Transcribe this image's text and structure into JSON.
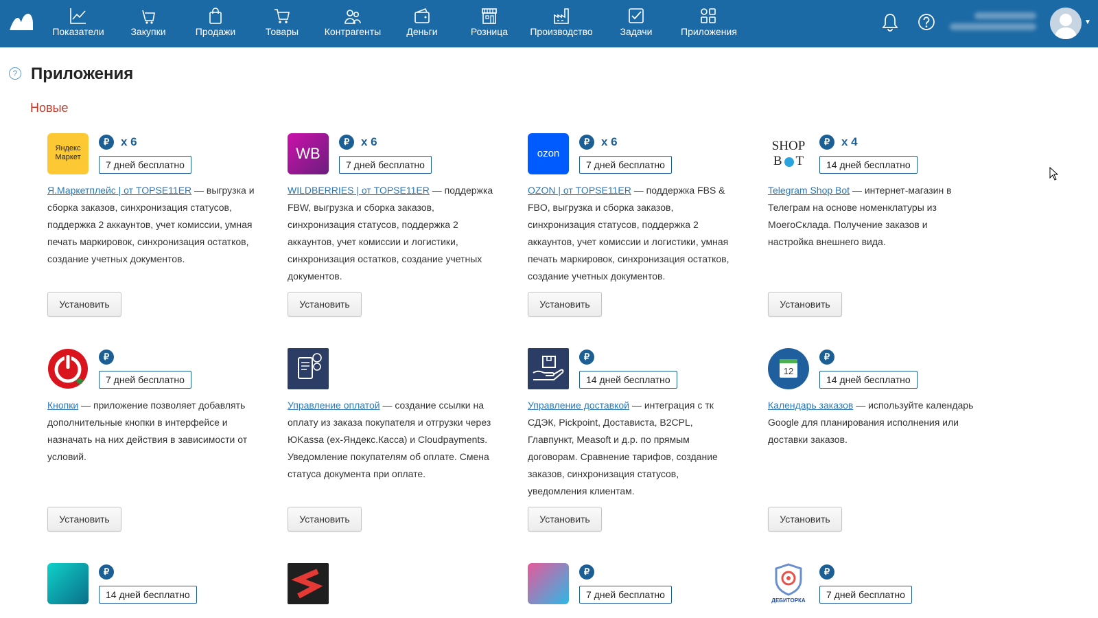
{
  "nav": {
    "items": [
      {
        "label": "Показатели",
        "icon": "chart-line-icon"
      },
      {
        "label": "Закупки",
        "icon": "basket-icon"
      },
      {
        "label": "Продажи",
        "icon": "shopping-bag-icon"
      },
      {
        "label": "Товары",
        "icon": "cart-icon"
      },
      {
        "label": "Контрагенты",
        "icon": "people-icon"
      },
      {
        "label": "Деньги",
        "icon": "wallet-icon"
      },
      {
        "label": "Розница",
        "icon": "storefront-icon"
      },
      {
        "label": "Производство",
        "icon": "factory-icon"
      },
      {
        "label": "Задачи",
        "icon": "checkbox-icon"
      },
      {
        "label": "Приложения",
        "icon": "apps-grid-icon"
      }
    ],
    "colors": {
      "bar": "#1c6aa5",
      "accent": "#1c5f95",
      "link": "#2a79b8",
      "section": "#c0392b"
    }
  },
  "page": {
    "title": "Приложения",
    "section": "Новые",
    "help": "?"
  },
  "apps": [
    {
      "logo_text": [
        "Яндекс",
        "Маркет"
      ],
      "currency": "₽",
      "mult": "x 6",
      "trial": "7 дней бесплатно",
      "link": "Я.Маркетплейс | от TOPSE11ER",
      "text": " — выгрузка и сборка заказов, синхронизация статусов, поддержка 2 аккаунтов, учет комиссии, умная печать маркировок, синхронизация остатков, создание учетных документов.",
      "button": "Установить"
    },
    {
      "logo_text": [
        "WB"
      ],
      "currency": "₽",
      "mult": "x 6",
      "trial": "7 дней бесплатно",
      "link": "WILDBERRIES | от TOPSE11ER",
      "text": " — поддержка FBW, выгрузка и сборка заказов, синхронизация статусов, поддержка 2 аккаунтов, учет комиссии и логистики, синхронизация остатков, создание учетных документов.",
      "button": "Установить"
    },
    {
      "logo_text": [
        "ozon"
      ],
      "currency": "₽",
      "mult": "x 6",
      "trial": "7 дней бесплатно",
      "link": "OZON | от TOPSE11ER",
      "text": " — поддержка FBS & FBO, выгрузка и сборка заказов, синхронизация статусов, поддержка 2 аккаунтов, учет комиссии и логистики, умная печать маркировок, синхронизация остатков, создание учетных документов.",
      "button": "Установить"
    },
    {
      "logo_text": [
        "SHOP",
        "B",
        "T"
      ],
      "currency": "₽",
      "mult": "x 4",
      "trial": "14 дней бесплатно",
      "link": "Telegram Shop Bot",
      "text": " — интернет-магазин в Телеграм на основе номенклатуры из МоегоСклада. Получение заказов и настройка внешнего вида.",
      "button": "Установить"
    },
    {
      "logo_text": [],
      "currency": "₽",
      "mult": "",
      "trial": "7 дней бесплатно",
      "link": "Кнопки",
      "text": " — приложение позволяет добавлять дополнительные кнопки в интерфейсе и назначать на них действия в зависимости от условий.",
      "button": "Установить"
    },
    {
      "logo_text": [],
      "currency": "",
      "mult": "",
      "trial": "",
      "link": "Управление оплатой",
      "text": " — создание ссылки на оплату из заказа покупателя и отгрузки через ЮKassa (ex-Яндекс.Касса) и Cloudpayments. Уведомление покупателям об оплате. Смена статуса документа при оплате.",
      "button": "Установить"
    },
    {
      "logo_text": [],
      "currency": "₽",
      "mult": "",
      "trial": "14 дней бесплатно",
      "link": "Управление доставкой",
      "text": " — интеграция с тк СДЭК, Pickpoint, Достависта, B2CPL, Главпункт, Measoft и д.р. по прямым договорам. Сравнение тарифов, создание заказов, синхронизация статусов, уведомления клиентам.",
      "button": "Установить"
    },
    {
      "logo_text": [
        "12"
      ],
      "currency": "₽",
      "mult": "",
      "trial": "14 дней бесплатно",
      "link": "Календарь заказов",
      "text": " — используйте календарь Google для планирования исполнения или доставки заказов.",
      "button": "Установить"
    },
    {
      "logo_text": [],
      "currency": "₽",
      "mult": "",
      "trial": "14 дней бесплатно",
      "link": "",
      "text": "",
      "button": ""
    },
    {
      "logo_text": [],
      "currency": "",
      "mult": "",
      "trial": "",
      "link": "",
      "text": "",
      "button": ""
    },
    {
      "logo_text": [],
      "currency": "₽",
      "mult": "",
      "trial": "7 дней бесплатно",
      "link": "",
      "text": "",
      "button": ""
    },
    {
      "logo_text": [
        "ДЕБИТОРКА"
      ],
      "currency": "₽",
      "mult": "",
      "trial": "7 дней бесплатно",
      "link": "",
      "text": "",
      "button": ""
    }
  ]
}
